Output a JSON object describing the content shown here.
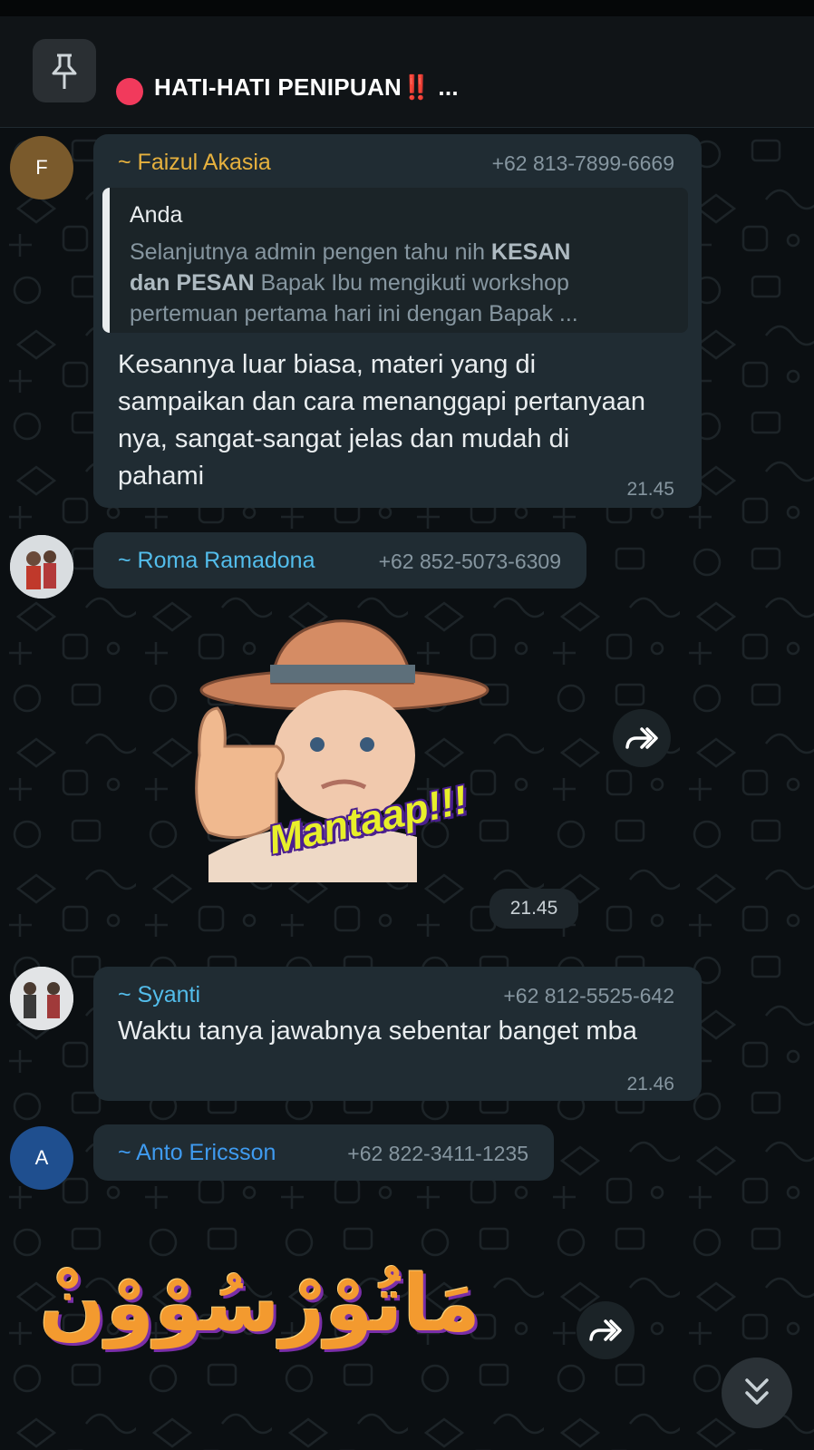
{
  "pinned": {
    "title": "HATI-HATI PENIPUAN",
    "emphasis": "‼️",
    "ellipsis": "..."
  },
  "messages": [
    {
      "avatar_letter": "F",
      "sender": "~ Faizul Akasia",
      "phone": "+62 813-7899-6669",
      "reply": {
        "author": "Anda",
        "text_lines": [
          {
            "pre": "Selanjutnya admin pengen tahu nih ",
            "bold": "KESAN"
          },
          {
            "bold": "dan PESAN",
            "post": " Bapak Ibu mengikuti workshop"
          },
          {
            "pre": "pertemuan pertama hari ini dengan Bapak ..."
          }
        ]
      },
      "text": "Kesannya luar biasa, materi yang di sampaikan dan cara menanggapi pertanyaan nya, sangat-sangat jelas dan mudah di pahami",
      "time": "21.45"
    },
    {
      "sender": "~ Roma Ramadona",
      "phone": "+62 852-5073-6309",
      "sticker": "thumbs-up baby sticker",
      "sticker_text": "Mantaap!!!",
      "time": "21.45"
    },
    {
      "sender": "~ Syanti",
      "phone": "+62 812-5525-642",
      "text": "Waktu tanya jawabnya sebentar banget mba",
      "time": "21.46"
    },
    {
      "avatar_letter": "A",
      "sender": "~ Anto Ericsson",
      "phone": "+62 822-3411-1235",
      "sticker_text": "مَاتُوْرْسُوْوْنْ"
    }
  ],
  "colors": {
    "bubble": "#202c33",
    "faizul_name": "#e6b13e",
    "roma_name": "#53bdeb",
    "syanti_name": "#53bdeb",
    "anto_name": "#3f9bf0",
    "pin_dot": "#f13a5c"
  },
  "icons": {
    "pin": "pin-icon",
    "forward": "forward-icon",
    "scroll_down": "double-chevron-down-icon"
  }
}
